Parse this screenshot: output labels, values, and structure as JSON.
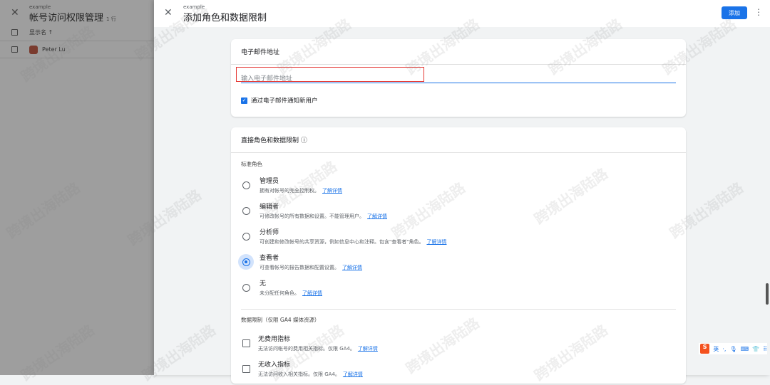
{
  "background_panel": {
    "subtitle": "example",
    "title": "帐号访问权限管理",
    "count": "1 行",
    "column_header": "显示名 ↑",
    "users": [
      "Peter Lu"
    ]
  },
  "dialog": {
    "subtitle": "example",
    "title": "添加角色和数据限制",
    "add_label": "添加"
  },
  "email_card": {
    "title": "电子邮件地址",
    "placeholder": "输入电子邮件地址",
    "notify_label": "通过电子邮件通知新用户",
    "notify_checked": true
  },
  "roles_card": {
    "title": "直接角色和数据限制 ⓘ",
    "standard_roles_label": "标准角色",
    "roles": [
      {
        "name": "管理员",
        "desc": "拥有对帐号的完全控制权。",
        "link": "了解详情",
        "selected": false
      },
      {
        "name": "编辑者",
        "desc": "可修改帐号的所有数据和设置。不能管理用户。",
        "link": "了解详情",
        "selected": false
      },
      {
        "name": "分析师",
        "desc": "可创建和修改帐号的共享资源，例如信息中心和注释。包含\"查看者\"角色。",
        "link": "了解详情",
        "selected": false
      },
      {
        "name": "查看者",
        "desc": "可查看帐号的报告数据和配置设置。",
        "link": "了解详情",
        "selected": true
      },
      {
        "name": "无",
        "desc": "未分配任何角色。",
        "link": "了解详情",
        "selected": false
      }
    ],
    "data_restrictions_label": "数据限制（仅限 GA4 媒体资源）",
    "restrictions": [
      {
        "name": "无费用指标",
        "desc": "无法访问帐号的费用相关指标。仅限 GA4。",
        "link": "了解详情",
        "checked": false
      },
      {
        "name": "无收入指标",
        "desc": "无法访问收入相关指标。仅限 GA4。",
        "link": "了解详情",
        "checked": false
      }
    ]
  },
  "watermark": "跨境出海陆路",
  "ime": {
    "logo": "S",
    "lang": "英"
  }
}
